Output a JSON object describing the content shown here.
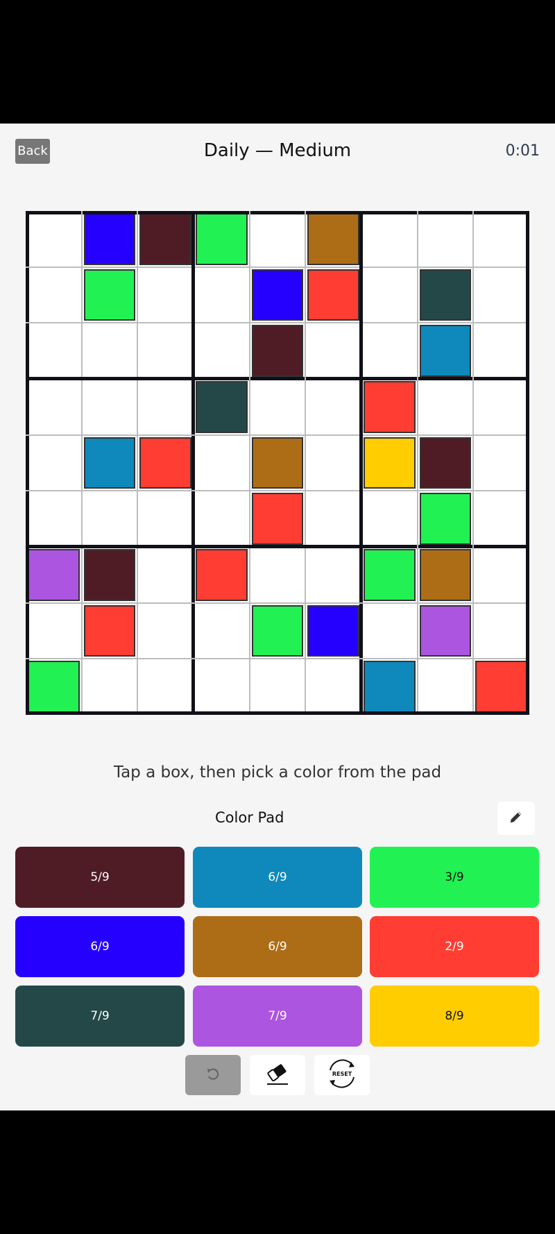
{
  "header": {
    "back_label": "Back",
    "title": "Daily — Medium",
    "timer": "0:01"
  },
  "hint": "Tap a box, then pick a color from the pad",
  "pad": {
    "title": "Color Pad",
    "colors": [
      {
        "name": "maroon",
        "hex": "#4f1c26",
        "count": "5/9",
        "text_color": "#ffffff"
      },
      {
        "name": "cyan-blue",
        "hex": "#0f89bc",
        "count": "6/9",
        "text_color": "#ffffff"
      },
      {
        "name": "green",
        "hex": "#22f153",
        "count": "3/9",
        "text_color": "#111111"
      },
      {
        "name": "blue",
        "hex": "#2600ff",
        "count": "6/9",
        "text_color": "#ffffff"
      },
      {
        "name": "brown",
        "hex": "#ad6d16",
        "count": "6/9",
        "text_color": "#ffffff"
      },
      {
        "name": "red",
        "hex": "#ff3d33",
        "count": "2/9",
        "text_color": "#ffffff"
      },
      {
        "name": "dark-teal",
        "hex": "#244848",
        "count": "7/9",
        "text_color": "#ffffff"
      },
      {
        "name": "purple",
        "hex": "#ac55e0",
        "count": "7/9",
        "text_color": "#ffffff"
      },
      {
        "name": "yellow",
        "hex": "#ffcd00",
        "count": "8/9",
        "text_color": "#111111"
      }
    ]
  },
  "board": {
    "grid": [
      [
        null,
        3,
        0,
        2,
        null,
        4,
        null,
        null,
        null
      ],
      [
        null,
        2,
        null,
        null,
        3,
        5,
        null,
        6,
        null
      ],
      [
        null,
        null,
        null,
        null,
        0,
        null,
        null,
        1,
        null
      ],
      [
        null,
        null,
        null,
        6,
        null,
        null,
        5,
        null,
        null
      ],
      [
        null,
        1,
        5,
        null,
        4,
        null,
        8,
        0,
        null
      ],
      [
        null,
        null,
        null,
        null,
        5,
        null,
        null,
        2,
        null
      ],
      [
        7,
        0,
        null,
        5,
        null,
        null,
        2,
        4,
        null
      ],
      [
        null,
        5,
        null,
        null,
        2,
        3,
        null,
        7,
        null
      ],
      [
        2,
        null,
        null,
        null,
        null,
        null,
        1,
        null,
        5
      ]
    ]
  },
  "tools": {
    "undo_icon": "undo-icon",
    "eraser_icon": "eraser-icon",
    "reset_icon": "reset-icon",
    "reset_label": "RESET"
  },
  "edit_icon": "pencil-icon"
}
